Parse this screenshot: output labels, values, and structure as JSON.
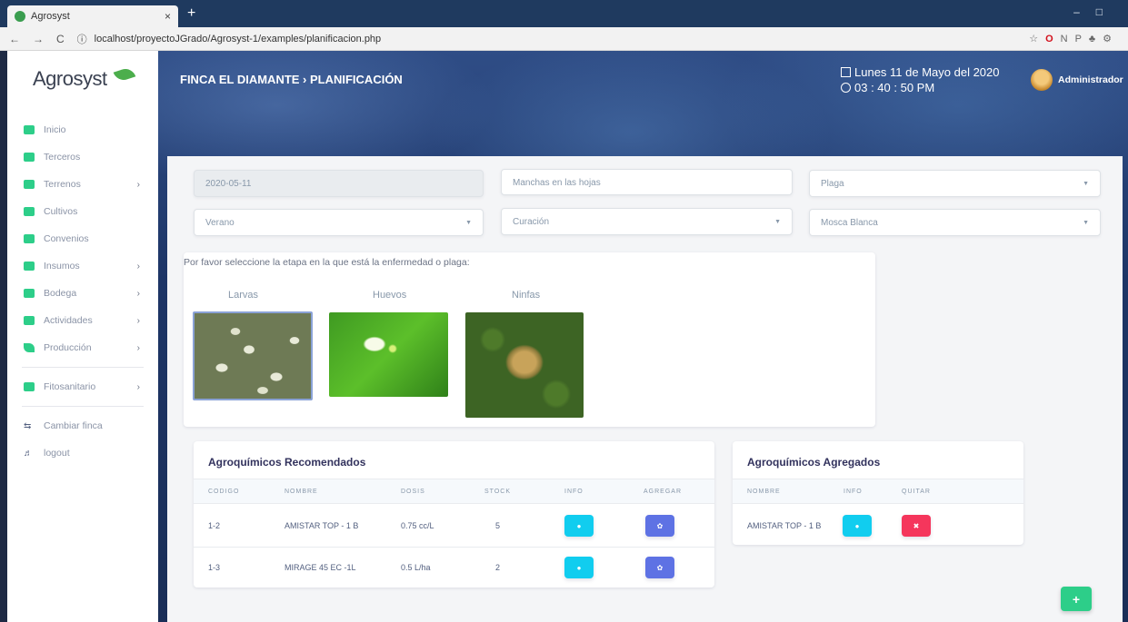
{
  "browser": {
    "tab_title": "Agrosyst",
    "tab_close": "×",
    "new_tab": "+",
    "url": "localhost/proyectoJGrado/Agrosyst-1/examples/planificacion.php"
  },
  "sidebar": {
    "logo": "Agrosyst",
    "items": [
      {
        "label": "Inicio",
        "icon": "home-icon",
        "color": "#2dce89",
        "chevron": ""
      },
      {
        "label": "Terceros",
        "icon": "users-icon",
        "color": "#2dce89",
        "chevron": ""
      },
      {
        "label": "Terrenos",
        "icon": "map-icon",
        "color": "#2dce89",
        "chevron": "›"
      },
      {
        "label": "Cultivos",
        "icon": "plant-icon",
        "color": "#2dce89",
        "chevron": ""
      },
      {
        "label": "Convenios",
        "icon": "handshake-icon",
        "color": "#2dce89",
        "chevron": ""
      },
      {
        "label": "Insumos",
        "icon": "map-icon",
        "color": "#2dce89",
        "chevron": "›"
      },
      {
        "label": "Bodega",
        "icon": "warehouse-icon",
        "color": "#2dce89",
        "chevron": "›"
      },
      {
        "label": "Actividades",
        "icon": "map-icon",
        "color": "#2dce89",
        "chevron": "›"
      },
      {
        "label": "Producción",
        "icon": "leaf-icon",
        "color": "#2dce89",
        "chevron": "›"
      }
    ],
    "fito": {
      "label": "Fitosanitario",
      "chevron": "›"
    },
    "cambiar": "Cambiar finca",
    "logout": "logout"
  },
  "header": {
    "breadcrumb": "FINCA EL DIAMANTE › PLANIFICACIÓN",
    "date": "Lunes 11 de Mayo del 2020",
    "time": "03 : 40 : 50 PM",
    "user": "Administrador"
  },
  "form": {
    "date_value": "2020-05-11",
    "symptom": "Manchas en las hojas",
    "type_select": "Plaga",
    "season_select": "Verano",
    "treatment_select": "Curación",
    "pest_select": "Mosca Blanca",
    "caret": "▼"
  },
  "stages": {
    "question": "Por favor seleccione la etapa en la que está la enfermedad o plaga:",
    "labels": [
      "Larvas",
      "Huevos",
      "Ninfas"
    ]
  },
  "recommended": {
    "title": "Agroquímicos Recomendados",
    "headers": [
      "CODIGO",
      "NOMBRE",
      "DOSIS",
      "STOCK",
      "INFO",
      "AGREGAR"
    ],
    "rows": [
      {
        "codigo": "1-2",
        "nombre": "AMISTAR TOP - 1 B",
        "dosis": "0.75 cc/L",
        "stock": "5"
      },
      {
        "codigo": "1-3",
        "nombre": "MIRAGE 45 EC -1L",
        "dosis": "0.5 L/ha",
        "stock": "2"
      }
    ]
  },
  "added": {
    "title": "Agroquímicos Agregados",
    "headers": [
      "NOMBRE",
      "INFO",
      "QUITAR"
    ],
    "rows": [
      {
        "nombre": "AMISTAR TOP - 1 B"
      }
    ]
  },
  "fab": "+"
}
